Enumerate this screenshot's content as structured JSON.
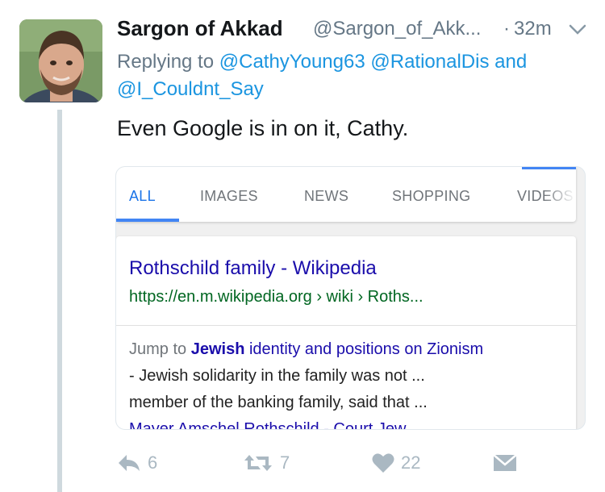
{
  "tweet": {
    "display_name": "Sargon of Akkad",
    "handle": "@Sargon_of_Akk...",
    "separator": "·",
    "timestamp": "32m",
    "reply_prefix": "Replying to",
    "mentions": [
      "@CathyYoung63",
      "@RationalDis",
      "@I_Couldnt_Say"
    ],
    "reply_and": "and",
    "text": "Even Google is in on it, Cathy."
  },
  "embed": {
    "tabs": [
      "ALL",
      "IMAGES",
      "NEWS",
      "SHOPPING",
      "VIDEOS"
    ],
    "active_tab": "ALL",
    "result": {
      "title": "Rothschild family - Wikipedia",
      "url": "https://en.m.wikipedia.org › wiki › Roths...",
      "snippet_jump": "Jump to",
      "snippet_bold": "Jewish",
      "snippet_link_rest": "identity and positions on Zionism",
      "snippet_line2": "- Jewish solidarity in the family was not ...",
      "snippet_line3": "member of the banking family, said that ...",
      "snippet_line4": "Mayer Amschel Rothschild - Court Jew"
    }
  },
  "actions": {
    "reply_count": "6",
    "retweet_count": "7",
    "like_count": "22"
  },
  "colors": {
    "link": "#1b95e0",
    "muted": "#657786",
    "google_blue": "#1a0dab",
    "google_green": "#006621",
    "icon_gray": "#aab8c2"
  },
  "icons": [
    "chevron-down-icon",
    "reply-icon",
    "retweet-icon",
    "heart-icon",
    "direct-message-icon"
  ]
}
